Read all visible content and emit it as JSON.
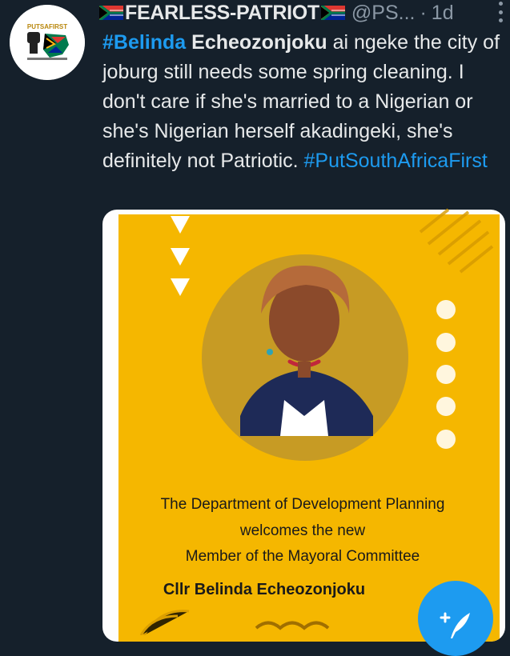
{
  "tweet": {
    "avatar_icon": "patriot-fist-flag-logo",
    "avatar_label": "PUTSAFIRST",
    "display_name": "FEARLESS-PATRIOT",
    "handle": "@PS...",
    "separator": "·",
    "time": "1d",
    "more_icon": "vertical-ellipsis-icon",
    "text": {
      "hashtag_belinda": "#Belinda",
      "bold_name": "Echeozonjoku",
      "body": " ai ngeke the city of joburg still needs some spring cleaning. I don't care if she's married to a Nigerian or she's Nigerian herself akadingeki, she's definitely not Patriotic.",
      "hashtag_psaf": "#PutSouthAfricaFirst"
    },
    "media": {
      "line1": "The Department of Development Planning",
      "line2": "welcomes the new",
      "line3": "Member of the Mayoral Committee",
      "name": "Cllr Belinda Echeozonjoku"
    }
  },
  "fab": {
    "icon": "compose-feather-plus-icon"
  },
  "colors": {
    "background": "#15202b",
    "text": "#e7e9ea",
    "muted": "#8b98a5",
    "accent": "#1d9bf0",
    "poster_yellow": "#f5b700"
  }
}
